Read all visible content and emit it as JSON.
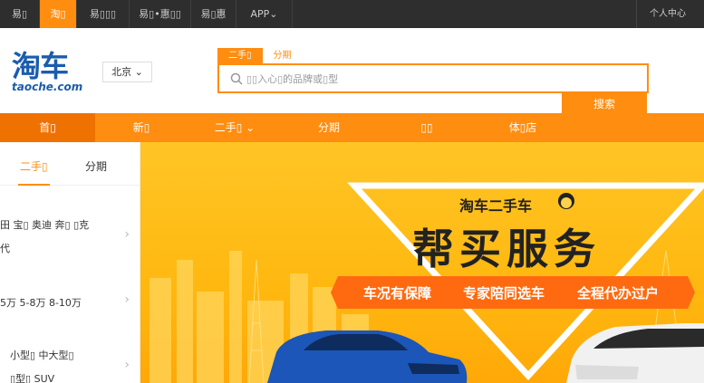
{
  "topbar": {
    "tabs": [
      "易▯",
      "淘▯",
      "易▯▯▯",
      "易▯•惠▯▯",
      "易▯惠",
      "APP⌄"
    ],
    "active_index": 1,
    "user_center": "个人中心"
  },
  "header": {
    "logo_mark": "淘车",
    "logo_domain": "taoche.com",
    "city": "北京 ⌄"
  },
  "search": {
    "tabs": [
      "二手▯",
      "分期"
    ],
    "active_tab": 0,
    "placeholder": "▯▯入心▯的品牌或▯型",
    "button": "搜索"
  },
  "nav": {
    "items": [
      "首▯",
      "新▯",
      "二手▯ ⌄",
      "分期",
      "▯▯",
      "体▯店"
    ],
    "active_index": 0
  },
  "sidebar": {
    "tabs": [
      "二手▯",
      "分期"
    ],
    "active_tab": 0,
    "brands_line1": "田  宝▯  奥迪  奔▯  ▯克",
    "brands_line2": "代",
    "prices": "5万  5-8万  8-10万",
    "types_line1": "小型▯  中大型▯",
    "types_line2": "▯型▯  SUV"
  },
  "banner": {
    "brand": "淘车二手车",
    "title": "帮买服务",
    "features": [
      "车况有保障",
      "专家陪同选车",
      "全程代办过户"
    ]
  },
  "colors": {
    "accent": "#ff8d10",
    "topbar_bg": "#2e2e2e",
    "logo_blue": "#1a5dae",
    "banner_yellow": "#ffc525",
    "banner_strip": "#ff6a10"
  }
}
